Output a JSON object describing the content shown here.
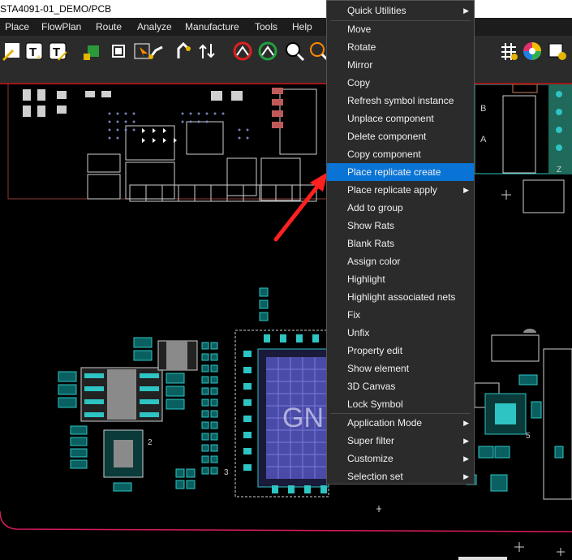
{
  "window": {
    "title": "STA4091-01_DEMO/PCB"
  },
  "menubar": {
    "items": [
      "Place",
      "FlowPlan",
      "Route",
      "Analyze",
      "Manufacture",
      "Tools",
      "Help"
    ]
  },
  "canvas": {
    "watermark_text": "GN",
    "silk_labels": [
      "Z",
      "B",
      "A",
      "2",
      "5",
      "Z",
      "3"
    ]
  },
  "context_menu": {
    "items": [
      {
        "label": "Quick Utilities",
        "submenu": true
      },
      {
        "label": "Move"
      },
      {
        "label": "Rotate"
      },
      {
        "label": "Mirror"
      },
      {
        "label": "Copy"
      },
      {
        "label": "Refresh symbol instance"
      },
      {
        "label": "Unplace component"
      },
      {
        "label": "Delete component"
      },
      {
        "label": "Copy component"
      },
      {
        "label": "Place replicate create",
        "highlighted": true
      },
      {
        "label": "Place replicate apply",
        "submenu": true
      },
      {
        "label": "Add to group"
      },
      {
        "label": "Show Rats"
      },
      {
        "label": "Blank Rats"
      },
      {
        "label": "Assign color"
      },
      {
        "label": "Highlight"
      },
      {
        "label": "Highlight associated nets"
      },
      {
        "label": "Fix"
      },
      {
        "label": "Unfix"
      },
      {
        "label": "Property edit"
      },
      {
        "label": "Show element"
      },
      {
        "label": "3D Canvas"
      },
      {
        "label": "Lock Symbol"
      },
      {
        "label": "Application Mode",
        "submenu": true
      },
      {
        "label": "Super filter",
        "submenu": true
      },
      {
        "label": "Customize",
        "submenu": true
      },
      {
        "label": "Selection set",
        "submenu": true
      }
    ],
    "highlight_color": "#0a74d6"
  },
  "colors": {
    "board_outline": "#d81b60",
    "pad": "#2ec4c4",
    "copper_pour": "#4a4aa8",
    "arrow": "#ff2020"
  }
}
